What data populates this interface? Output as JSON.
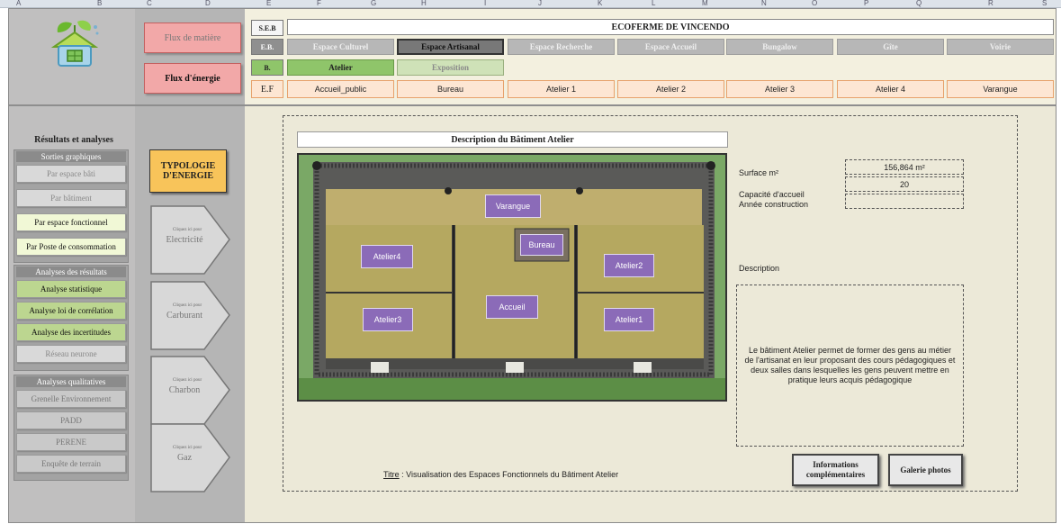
{
  "column_headers": [
    "A",
    "B",
    "C",
    "D",
    "E",
    "F",
    "G",
    "H",
    "I",
    "J",
    "K",
    "L",
    "M",
    "N",
    "O",
    "P",
    "Q",
    "R",
    "S"
  ],
  "title": "ECOFERME DE VINCENDO",
  "row_tags": {
    "seb": "S.E.B",
    "eb": "E.B.",
    "b": "B.",
    "ef": "E.F"
  },
  "espaces_batis": [
    {
      "label": "Espace Culturel",
      "active": false
    },
    {
      "label": "Espace Artisanal",
      "active": true
    },
    {
      "label": "Espace Recherche",
      "active": false
    },
    {
      "label": "Espace Accueil",
      "active": false
    },
    {
      "label": "Bungalow",
      "active": false
    },
    {
      "label": "Gîte",
      "active": false
    },
    {
      "label": "Voirie",
      "active": false
    }
  ],
  "batiments": [
    {
      "label": "Atelier",
      "active": true
    },
    {
      "label": "Exposition",
      "active": false
    }
  ],
  "espaces_fonctionnels": [
    "Accueil_public",
    "Bureau",
    "Atelier 1",
    "Atelier 2",
    "Atelier 3",
    "Atelier 4",
    "Varangue"
  ],
  "flux": {
    "matiere": "Flux de matière",
    "energie": "Flux d'énergie"
  },
  "sidebar": {
    "heading": "Résultats et analyses",
    "sorties_header": "Sorties graphiques",
    "sorties": [
      {
        "label": "Par espace bâti",
        "style": "g"
      },
      {
        "label": "Par bâtiment",
        "style": "g"
      },
      {
        "label": "Par espace fonctionnel",
        "style": "lg"
      },
      {
        "label": "Par Poste de consommation",
        "style": "lg"
      }
    ],
    "analyses_header": "Analyses des résultats",
    "analyses": [
      {
        "label": "Analyse statistique",
        "style": "mg"
      },
      {
        "label": "Analyse loi de corrélation",
        "style": "mg"
      },
      {
        "label": "Analyse des incertitudes",
        "style": "mg"
      },
      {
        "label": "Réseau neurone",
        "style": "g"
      }
    ],
    "qualitatives_header": "Analyses qualitatives",
    "qualitatives": [
      {
        "label": "Grenelle Environnement",
        "style": "gd"
      },
      {
        "label": "PADD",
        "style": "gd"
      },
      {
        "label": "PERENE",
        "style": "gd"
      },
      {
        "label": "Enquête de terrain",
        "style": "gd"
      }
    ]
  },
  "typologie": "TYPOLOGIE D'ENERGIE",
  "energies": [
    {
      "small": "Cliquez ici pour",
      "label": "Electricité"
    },
    {
      "small": "Cliquez ici pour",
      "label": "Carburant"
    },
    {
      "small": "Cliquez ici pour",
      "label": "Charbon"
    },
    {
      "small": "Cliquez ici pour",
      "label": "Gaz"
    }
  ],
  "main": {
    "description_title": "Description du Bâtiment Atelier",
    "rooms": {
      "varangue": "Varangue",
      "bureau": "Bureau",
      "atelier4": "Atelier4",
      "atelier2": "Atelier2",
      "accueil": "Accueil",
      "atelier3": "Atelier3",
      "atelier1": "Atelier1"
    },
    "surface_label": "Surface m²",
    "surface_value": "156,864 m²",
    "capacite_label": "Capacité d'accueil",
    "capacite_value": "20",
    "annee_label": "Année construction",
    "annee_value": "",
    "description_label": "Description",
    "description_text": "Le bâtiment Atelier permet de former des gens au métier de l'artisanat en leur proposant des cours pédagogiques et deux salles dans lesquelles les gens peuvent mettre en pratique leurs acquis pédagogique",
    "caption_prefix": "Titre",
    "caption_text": " : Visualisation des Espaces Fonctionnels du Bâtiment Atelier",
    "btn_info": "Informations complémentaires",
    "btn_gallery": "Galerie photos"
  }
}
